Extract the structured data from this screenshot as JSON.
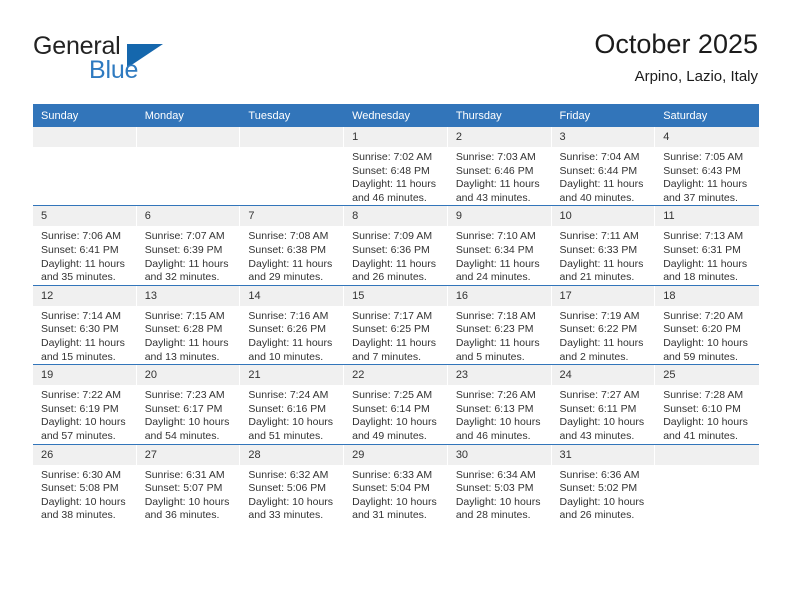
{
  "brand": {
    "name_top": "General",
    "name_bottom": "Blue",
    "triangle_icon": "blue-triangle-logo",
    "color_top": "#232323",
    "color_bottom": "#2e7ac0",
    "color_triangle": "#1567ad"
  },
  "header": {
    "title": "October 2025",
    "subtitle": "Arpino, Lazio, Italy"
  },
  "theme": {
    "header_blue": "#3275ba",
    "daynum_band": "#f0f0f0",
    "text": "#333333"
  },
  "calendar": {
    "weekday_headers": [
      "Sunday",
      "Monday",
      "Tuesday",
      "Wednesday",
      "Thursday",
      "Friday",
      "Saturday"
    ],
    "labels": {
      "sunrise": "Sunrise:",
      "sunset": "Sunset:",
      "daylight": "Daylight:"
    },
    "weeks": [
      [
        {
          "day": "",
          "empty": true
        },
        {
          "day": "",
          "empty": true
        },
        {
          "day": "",
          "empty": true
        },
        {
          "day": "1",
          "sunrise": "Sunrise: 7:02 AM",
          "sunset": "Sunset: 6:48 PM",
          "daylight": "Daylight: 11 hours and 46 minutes."
        },
        {
          "day": "2",
          "sunrise": "Sunrise: 7:03 AM",
          "sunset": "Sunset: 6:46 PM",
          "daylight": "Daylight: 11 hours and 43 minutes."
        },
        {
          "day": "3",
          "sunrise": "Sunrise: 7:04 AM",
          "sunset": "Sunset: 6:44 PM",
          "daylight": "Daylight: 11 hours and 40 minutes."
        },
        {
          "day": "4",
          "sunrise": "Sunrise: 7:05 AM",
          "sunset": "Sunset: 6:43 PM",
          "daylight": "Daylight: 11 hours and 37 minutes."
        }
      ],
      [
        {
          "day": "5",
          "sunrise": "Sunrise: 7:06 AM",
          "sunset": "Sunset: 6:41 PM",
          "daylight": "Daylight: 11 hours and 35 minutes."
        },
        {
          "day": "6",
          "sunrise": "Sunrise: 7:07 AM",
          "sunset": "Sunset: 6:39 PM",
          "daylight": "Daylight: 11 hours and 32 minutes."
        },
        {
          "day": "7",
          "sunrise": "Sunrise: 7:08 AM",
          "sunset": "Sunset: 6:38 PM",
          "daylight": "Daylight: 11 hours and 29 minutes."
        },
        {
          "day": "8",
          "sunrise": "Sunrise: 7:09 AM",
          "sunset": "Sunset: 6:36 PM",
          "daylight": "Daylight: 11 hours and 26 minutes."
        },
        {
          "day": "9",
          "sunrise": "Sunrise: 7:10 AM",
          "sunset": "Sunset: 6:34 PM",
          "daylight": "Daylight: 11 hours and 24 minutes."
        },
        {
          "day": "10",
          "sunrise": "Sunrise: 7:11 AM",
          "sunset": "Sunset: 6:33 PM",
          "daylight": "Daylight: 11 hours and 21 minutes."
        },
        {
          "day": "11",
          "sunrise": "Sunrise: 7:13 AM",
          "sunset": "Sunset: 6:31 PM",
          "daylight": "Daylight: 11 hours and 18 minutes."
        }
      ],
      [
        {
          "day": "12",
          "sunrise": "Sunrise: 7:14 AM",
          "sunset": "Sunset: 6:30 PM",
          "daylight": "Daylight: 11 hours and 15 minutes."
        },
        {
          "day": "13",
          "sunrise": "Sunrise: 7:15 AM",
          "sunset": "Sunset: 6:28 PM",
          "daylight": "Daylight: 11 hours and 13 minutes."
        },
        {
          "day": "14",
          "sunrise": "Sunrise: 7:16 AM",
          "sunset": "Sunset: 6:26 PM",
          "daylight": "Daylight: 11 hours and 10 minutes."
        },
        {
          "day": "15",
          "sunrise": "Sunrise: 7:17 AM",
          "sunset": "Sunset: 6:25 PM",
          "daylight": "Daylight: 11 hours and 7 minutes."
        },
        {
          "day": "16",
          "sunrise": "Sunrise: 7:18 AM",
          "sunset": "Sunset: 6:23 PM",
          "daylight": "Daylight: 11 hours and 5 minutes."
        },
        {
          "day": "17",
          "sunrise": "Sunrise: 7:19 AM",
          "sunset": "Sunset: 6:22 PM",
          "daylight": "Daylight: 11 hours and 2 minutes."
        },
        {
          "day": "18",
          "sunrise": "Sunrise: 7:20 AM",
          "sunset": "Sunset: 6:20 PM",
          "daylight": "Daylight: 10 hours and 59 minutes."
        }
      ],
      [
        {
          "day": "19",
          "sunrise": "Sunrise: 7:22 AM",
          "sunset": "Sunset: 6:19 PM",
          "daylight": "Daylight: 10 hours and 57 minutes."
        },
        {
          "day": "20",
          "sunrise": "Sunrise: 7:23 AM",
          "sunset": "Sunset: 6:17 PM",
          "daylight": "Daylight: 10 hours and 54 minutes."
        },
        {
          "day": "21",
          "sunrise": "Sunrise: 7:24 AM",
          "sunset": "Sunset: 6:16 PM",
          "daylight": "Daylight: 10 hours and 51 minutes."
        },
        {
          "day": "22",
          "sunrise": "Sunrise: 7:25 AM",
          "sunset": "Sunset: 6:14 PM",
          "daylight": "Daylight: 10 hours and 49 minutes."
        },
        {
          "day": "23",
          "sunrise": "Sunrise: 7:26 AM",
          "sunset": "Sunset: 6:13 PM",
          "daylight": "Daylight: 10 hours and 46 minutes."
        },
        {
          "day": "24",
          "sunrise": "Sunrise: 7:27 AM",
          "sunset": "Sunset: 6:11 PM",
          "daylight": "Daylight: 10 hours and 43 minutes."
        },
        {
          "day": "25",
          "sunrise": "Sunrise: 7:28 AM",
          "sunset": "Sunset: 6:10 PM",
          "daylight": "Daylight: 10 hours and 41 minutes."
        }
      ],
      [
        {
          "day": "26",
          "sunrise": "Sunrise: 6:30 AM",
          "sunset": "Sunset: 5:08 PM",
          "daylight": "Daylight: 10 hours and 38 minutes."
        },
        {
          "day": "27",
          "sunrise": "Sunrise: 6:31 AM",
          "sunset": "Sunset: 5:07 PM",
          "daylight": "Daylight: 10 hours and 36 minutes."
        },
        {
          "day": "28",
          "sunrise": "Sunrise: 6:32 AM",
          "sunset": "Sunset: 5:06 PM",
          "daylight": "Daylight: 10 hours and 33 minutes."
        },
        {
          "day": "29",
          "sunrise": "Sunrise: 6:33 AM",
          "sunset": "Sunset: 5:04 PM",
          "daylight": "Daylight: 10 hours and 31 minutes."
        },
        {
          "day": "30",
          "sunrise": "Sunrise: 6:34 AM",
          "sunset": "Sunset: 5:03 PM",
          "daylight": "Daylight: 10 hours and 28 minutes."
        },
        {
          "day": "31",
          "sunrise": "Sunrise: 6:36 AM",
          "sunset": "Sunset: 5:02 PM",
          "daylight": "Daylight: 10 hours and 26 minutes."
        },
        {
          "day": "",
          "empty": true
        }
      ]
    ]
  }
}
